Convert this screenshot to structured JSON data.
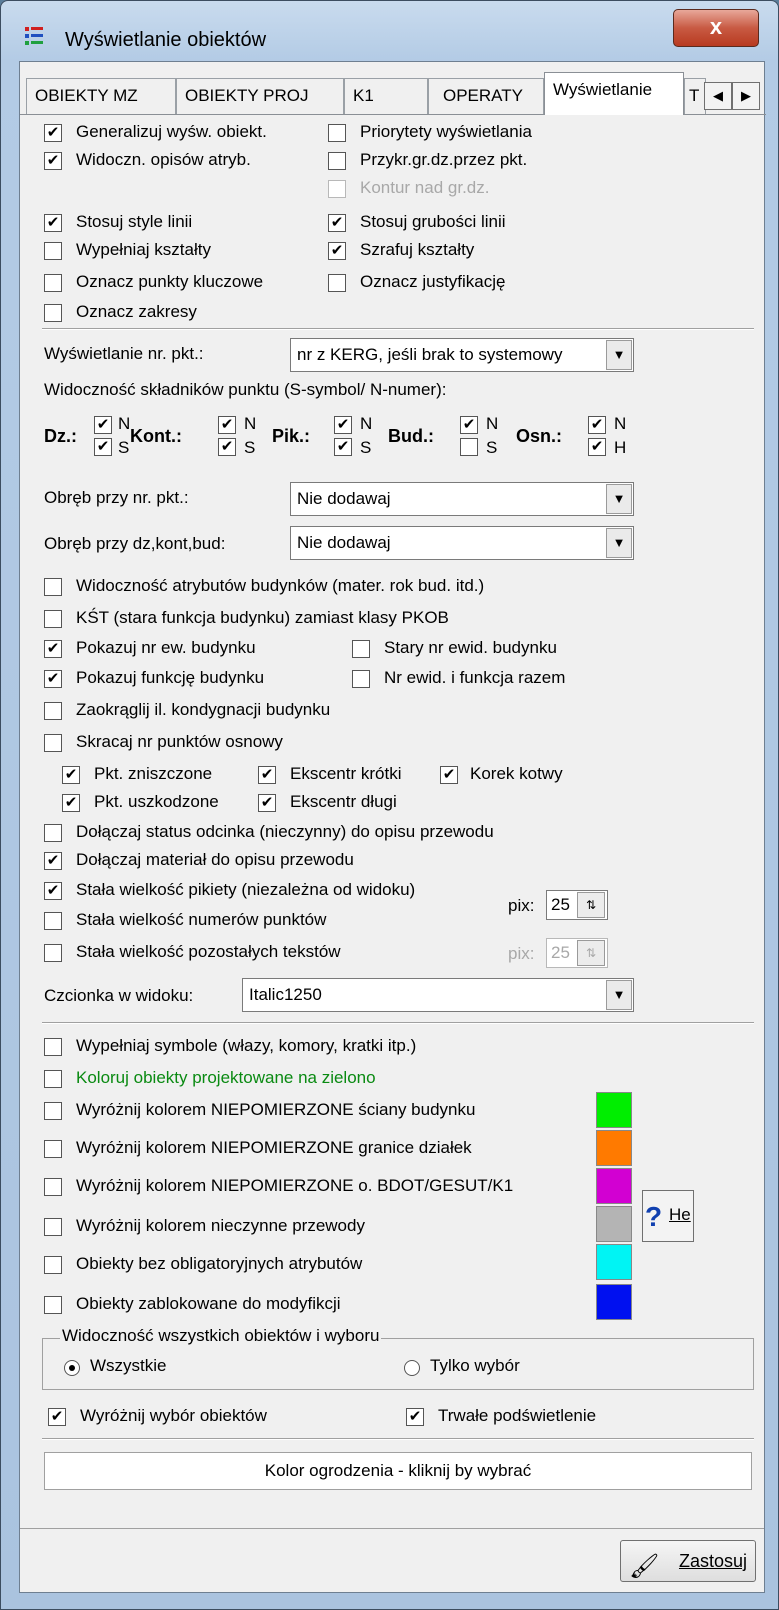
{
  "window": {
    "title": "Wyświetlanie obiektów",
    "close_label": "x"
  },
  "tabs": [
    {
      "label": "OBIEKTY MZ"
    },
    {
      "label": "OBIEKTY PROJ"
    },
    {
      "label": "K1"
    },
    {
      "label": "OPERATY"
    },
    {
      "label": "Wyświetlanie"
    },
    {
      "label": "T"
    }
  ],
  "options": {
    "generalize": {
      "label": "Generalizuj wyśw. obiekt.",
      "checked": true
    },
    "priorities": {
      "label": "Priorytety wyświetlania",
      "checked": false
    },
    "attr_desc_visibility": {
      "label": "Widoczn. opisów atryb.",
      "checked": true
    },
    "clip_boundary": {
      "label": "Przykr.gr.dz.przez pkt.",
      "checked": false
    },
    "contour_over": {
      "label": "Kontur nad gr.dz.",
      "checked": false,
      "disabled": true
    },
    "line_styles": {
      "label": "Stosuj style linii",
      "checked": true
    },
    "line_widths": {
      "label": "Stosuj grubości linii",
      "checked": true
    },
    "fill_shapes": {
      "label": "Wypełniaj kształty",
      "checked": false
    },
    "hatch_shapes": {
      "label": "Szrafuj kształty",
      "checked": true
    },
    "mark_key_points": {
      "label": "Oznacz punkty kluczowe",
      "checked": false
    },
    "mark_justification": {
      "label": "Oznacz justyfikację",
      "checked": false
    },
    "mark_ranges": {
      "label": "Oznacz zakresy",
      "checked": false
    }
  },
  "point_number": {
    "label": "Wyświetlanie nr. pkt.:",
    "value": "nr z KERG, jeśli brak to systemowy"
  },
  "point_components": {
    "label": "Widoczność składników punktu (S-symbol/ N-numer):",
    "groups": [
      {
        "label": "Dz.:",
        "top_letter": "N",
        "bottom_letter": "S",
        "top": true,
        "bottom": true
      },
      {
        "label": "Kont.:",
        "top_letter": "N",
        "bottom_letter": "S",
        "top": true,
        "bottom": true
      },
      {
        "label": "Pik.:",
        "top_letter": "N",
        "bottom_letter": "S",
        "top": true,
        "bottom": true
      },
      {
        "label": "Bud.:",
        "top_letter": "N",
        "bottom_letter": "S",
        "top": true,
        "bottom": false
      },
      {
        "label": "Osn.:",
        "top_letter": "N",
        "bottom_letter": "H",
        "top": true,
        "bottom": true
      }
    ]
  },
  "precinct_point": {
    "label": "Obręb przy nr. pkt.:",
    "value": "Nie dodawaj"
  },
  "precinct_objects": {
    "label": "Obręb przy dz,kont,bud:",
    "value": "Nie dodawaj"
  },
  "building": {
    "attr_visibility": {
      "label": "Widoczność atrybutów budynków (mater. rok bud. itd.)",
      "checked": false
    },
    "kst_instead_pkob": {
      "label": "KŚT (stara funkcja budynku) zamiast klasy PKOB",
      "checked": false
    },
    "show_ew_number": {
      "label": "Pokazuj nr ew. budynku",
      "checked": true
    },
    "old_ew_number": {
      "label": "Stary nr ewid. budynku",
      "checked": false
    },
    "show_function": {
      "label": "Pokazuj funkcję budynku",
      "checked": true
    },
    "number_and_function": {
      "label": "Nr ewid. i funkcja razem",
      "checked": false
    },
    "round_floors": {
      "label": "Zaokrąglij il. kondygnacji budynku",
      "checked": false
    }
  },
  "control_points": {
    "shorten": {
      "label": "Skracaj nr punktów osnowy",
      "checked": false
    },
    "destroyed": {
      "label": "Pkt. zniszczone",
      "checked": true
    },
    "ecc_short": {
      "label": "Ekscentr krótki",
      "checked": true
    },
    "anchor_plug": {
      "label": "Korek kotwy",
      "checked": true
    },
    "damaged": {
      "label": "Pkt. uszkodzone",
      "checked": true
    },
    "ecc_long": {
      "label": "Ekscentr długi",
      "checked": true
    }
  },
  "pipes": {
    "status": {
      "label": "Dołączaj status odcinka (nieczynny) do opisu przewodu",
      "checked": false
    },
    "material": {
      "label": "Dołączaj materiał do opisu przewodu",
      "checked": true
    }
  },
  "sizes": {
    "picket": {
      "label": "Stała wielkość pikiety (niezależna od widoku)",
      "checked": true
    },
    "point_numbers": {
      "label": "Stała wielkość numerów punktów",
      "checked": false
    },
    "other_texts": {
      "label": "Stała wielkość pozostałych tekstów",
      "checked": false
    },
    "pix_label": "pix:",
    "pix_value_1": "25",
    "pix_value_2": "25"
  },
  "font": {
    "label": "Czcionka w widoku:",
    "value": "Italic1250"
  },
  "highlight": {
    "fill_symbols": {
      "label": "Wypełniaj symbole (włazy, komory, kratki itp.)",
      "checked": false
    },
    "color_projected": {
      "label": "Koloruj obiekty projektowane na zielono",
      "checked": false
    },
    "unmeasured_walls": {
      "label": "Wyróżnij kolorem NIEPOMIERZONE ściany budynku",
      "checked": false,
      "color": "#00ee00"
    },
    "unmeasured_parcels": {
      "label": "Wyróżnij kolorem NIEPOMIERZONE granice działek",
      "checked": false,
      "color": "#ff7a00"
    },
    "unmeasured_bdot": {
      "label": "Wyróżnij kolorem NIEPOMIERZONE o. BDOT/GESUT/K1",
      "checked": false,
      "color": "#d200d2"
    },
    "inactive_pipes": {
      "label": "Wyróżnij kolorem nieczynne przewody",
      "checked": false,
      "color": "#b4b4b4"
    },
    "no_obligatory_attrs": {
      "label": "Obiekty bez obligatoryjnych atrybutów",
      "checked": false,
      "color": "#00f4f4"
    },
    "locked_objects": {
      "label": "Obiekty zablokowane do modyfikcji",
      "checked": false,
      "color": "#0010f0"
    }
  },
  "help_button": {
    "label": "He"
  },
  "visibility_group": {
    "legend": "Widoczność wszystkich obiektów i wyboru",
    "all": {
      "label": "Wszystkie",
      "selected": true
    },
    "selection_only": {
      "label": "Tylko wybór",
      "selected": false
    }
  },
  "selection": {
    "highlight": {
      "label": "Wyróżnij wybór obiektów",
      "checked": true
    },
    "permanent": {
      "label": "Trwałe podświetlenie",
      "checked": true
    }
  },
  "fence_color": {
    "label": "Kolor ogrodzenia - kliknij by wybrać"
  },
  "apply_button": {
    "label": "Zastosuj"
  },
  "check_glyph": "✔",
  "colors": {
    "green_text": "#0a8a12"
  }
}
